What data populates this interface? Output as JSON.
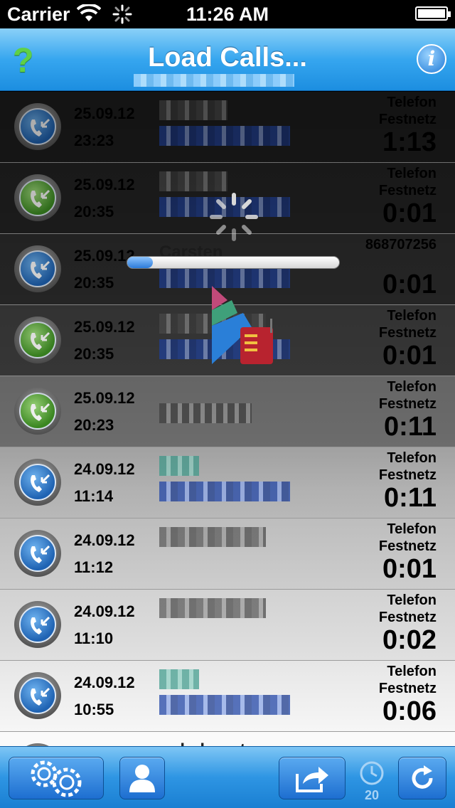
{
  "status_bar": {
    "carrier": "Carrier",
    "time": "11:26 AM"
  },
  "nav": {
    "title": "Load Calls...",
    "help_label": "?",
    "info_label": "i"
  },
  "loading": {
    "progress": 0.12
  },
  "calls": [
    {
      "date": "25.09.12",
      "time": "23:23",
      "name": "",
      "line1": "Telefon",
      "line2": "Festnetz",
      "duration": "1:13",
      "icon": "blue"
    },
    {
      "date": "25.09.12",
      "time": "20:35",
      "name": "",
      "line1": "Telefon",
      "line2": "Festnetz",
      "duration": "0:01",
      "icon": "green"
    },
    {
      "date": "25.09.12",
      "time": "20:35",
      "name": "Carsten",
      "line1": "868707256",
      "line2": "",
      "duration": "0:01",
      "icon": "blue"
    },
    {
      "date": "25.09.12",
      "time": "20:35",
      "name": "",
      "line1": "Telefon",
      "line2": "Festnetz",
      "duration": "0:01",
      "icon": "green"
    },
    {
      "date": "25.09.12",
      "time": "20:23",
      "name": "",
      "line1": "Telefon",
      "line2": "Festnetz",
      "duration": "0:11",
      "icon": "green"
    },
    {
      "date": "24.09.12",
      "time": "11:14",
      "name": "",
      "line1": "Telefon",
      "line2": "Festnetz",
      "duration": "0:11",
      "icon": "blue"
    },
    {
      "date": "24.09.12",
      "time": "11:12",
      "name": "",
      "line1": "Telefon",
      "line2": "Festnetz",
      "duration": "0:01",
      "icon": "blue"
    },
    {
      "date": "24.09.12",
      "time": "11:10",
      "name": "",
      "line1": "Telefon",
      "line2": "Festnetz",
      "duration": "0:02",
      "icon": "blue"
    },
    {
      "date": "24.09.12",
      "time": "10:55",
      "name": "",
      "line1": "Telefon",
      "line2": "Festnetz",
      "duration": "0:06",
      "icon": "blue"
    }
  ],
  "partial_row": {
    "name": "unbekannt"
  },
  "toolbar": {
    "timer_count": "20"
  },
  "icons": [
    "question-icon",
    "info-icon",
    "settings-icon",
    "contacts-icon",
    "share-icon",
    "timer-icon",
    "refresh-icon",
    "incoming-call-icon"
  ],
  "colors": {
    "nav_blue": "#2e95e3",
    "help_green": "#5fd047"
  }
}
